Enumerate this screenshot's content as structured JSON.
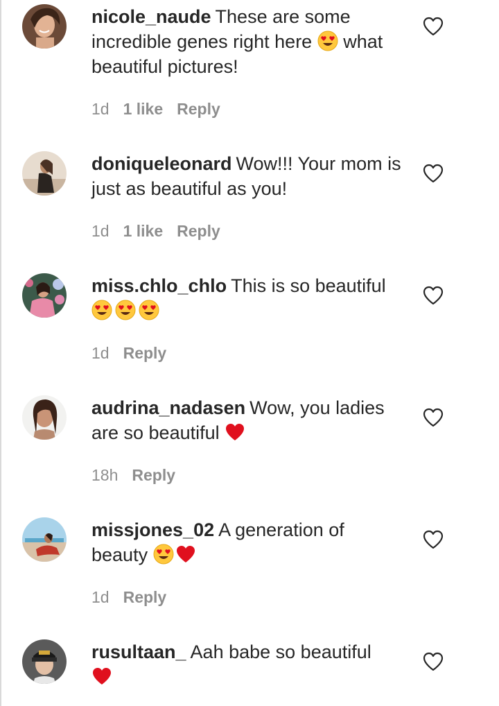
{
  "comments": [
    {
      "username": "nicole_naude",
      "text_parts": [
        "These are some incredible genes right here",
        "what beautiful pictures!"
      ],
      "time": "1d",
      "likes": "1 like",
      "reply": "Reply"
    },
    {
      "username": "doniqueleonard",
      "text_parts": [
        "Wow!!! Your mom is just as beautiful as you!"
      ],
      "time": "1d",
      "likes": "1 like",
      "reply": "Reply"
    },
    {
      "username": "miss.chlo_chlo",
      "text_parts": [
        "This is so beautiful"
      ],
      "time": "1d",
      "reply": "Reply"
    },
    {
      "username": "audrina_nadasen",
      "text_parts": [
        "Wow, you ladies are so beautiful"
      ],
      "time": "18h",
      "reply": "Reply"
    },
    {
      "username": "missjones_02",
      "text_parts": [
        "A generation of beauty"
      ],
      "time": "1d",
      "reply": "Reply"
    },
    {
      "username": "rusultaan_",
      "text_parts": [
        "Aah babe so beautiful"
      ]
    }
  ],
  "icons": {
    "like": "heart-outline-icon",
    "emoji_heart_eyes": "heart-eyes-emoji",
    "emoji_red_heart": "red-heart-emoji"
  },
  "colors": {
    "text": "#262626",
    "meta": "#8e8e8e",
    "heart_red": "#e0101e",
    "emoji_yellow": "#ffc83d"
  }
}
